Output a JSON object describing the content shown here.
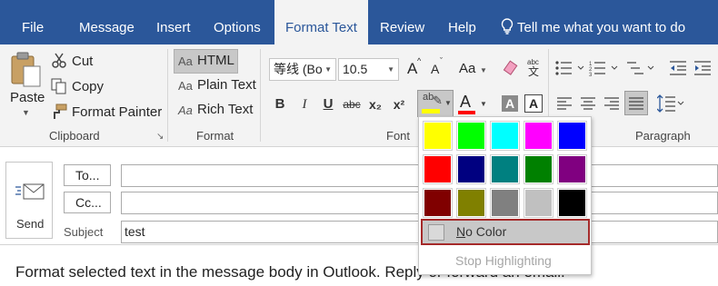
{
  "tabs": [
    "File",
    "Message",
    "Insert",
    "Options",
    "Format Text",
    "Review",
    "Help"
  ],
  "active_tab": "Format Text",
  "tell_me": "Tell me what you want to do",
  "clipboard": {
    "paste": "Paste",
    "cut": "Cut",
    "copy": "Copy",
    "format_painter": "Format Painter",
    "group_label": "Clipboard"
  },
  "format": {
    "html": "HTML",
    "plain_text": "Plain Text",
    "rich_text": "Rich Text",
    "prefix": "Aa",
    "group_label": "Format"
  },
  "font": {
    "font_name": "等线 (Bo",
    "font_size": "10.5",
    "grow": "A",
    "shrink": "A",
    "change_case": "Aa",
    "bold": "B",
    "italic": "I",
    "underline": "U",
    "strike": "abc",
    "subscript": "x₂",
    "superscript": "x²",
    "highlight_label": "ab",
    "font_color_label": "A",
    "group_label": "Font"
  },
  "paragraph": {
    "group_label": "Paragraph"
  },
  "message": {
    "send": "Send",
    "to": "To...",
    "cc": "Cc...",
    "subject_label": "Subject",
    "subject_value": "test",
    "body_text": "Format selected text in the message body in Outlook. Reply or forward an email.↵"
  },
  "highlight_menu": {
    "colors": [
      "#ffff00",
      "#00ff00",
      "#00ffff",
      "#ff00ff",
      "#0000ff",
      "#ff0000",
      "#000080",
      "#008080",
      "#008000",
      "#800080",
      "#800000",
      "#808000",
      "#808080",
      "#c0c0c0",
      "#000000"
    ],
    "no_color": "No Color",
    "stop_highlighting": "Stop Highlighting"
  },
  "colors": {
    "accent": "#2b579a",
    "highlight_yellow": "#ffff00",
    "font_red": "#ff0000",
    "selection_border": "#a52a2a"
  }
}
